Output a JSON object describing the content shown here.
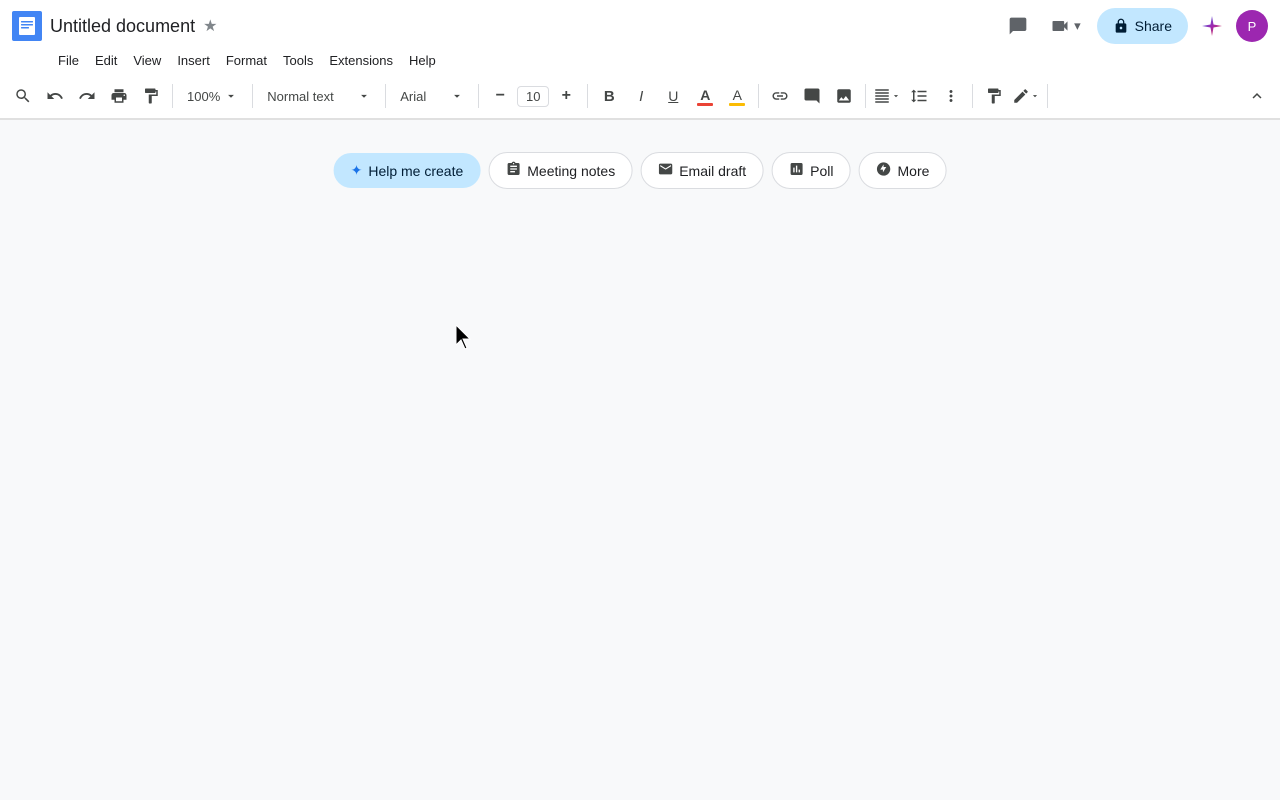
{
  "title_bar": {
    "doc_title": "Untitled document",
    "star_label": "★"
  },
  "menu": {
    "items": [
      "File",
      "Edit",
      "View",
      "Insert",
      "Format",
      "Tools",
      "Extensions",
      "Help"
    ]
  },
  "header": {
    "comment_icon": "💬",
    "camera_label": "📹",
    "share_label": "Share",
    "lock_icon": "🔒",
    "gemini_icon": "✦",
    "avatar_initials": "P"
  },
  "toolbar": {
    "zoom": "100%",
    "text_style": "Normal text",
    "font": "Arial",
    "font_size": "10",
    "search_icon": "🔍",
    "undo_icon": "↩",
    "redo_icon": "↪",
    "print_icon": "🖨",
    "paint_format_icon": "🖌",
    "zoom_dropdown": "▾",
    "text_style_dropdown": "▾",
    "font_dropdown": "▾",
    "decrease_font": "−",
    "increase_font": "+",
    "bold": "B",
    "italic": "I",
    "underline": "U",
    "text_color": "A",
    "highlight": "A",
    "link": "🔗",
    "comment": "💬",
    "image": "🖼",
    "align": "≡",
    "line_spacing": "↕",
    "more": "⋮",
    "paint_icon": "🎨",
    "pen_icon": "✏"
  },
  "suggestion_chips": {
    "help_me_create": "Help me create",
    "meeting_notes": "Meeting notes",
    "email_draft": "Email draft",
    "poll": "Poll",
    "more": "More"
  },
  "doc": {
    "chip_star": "✦"
  }
}
